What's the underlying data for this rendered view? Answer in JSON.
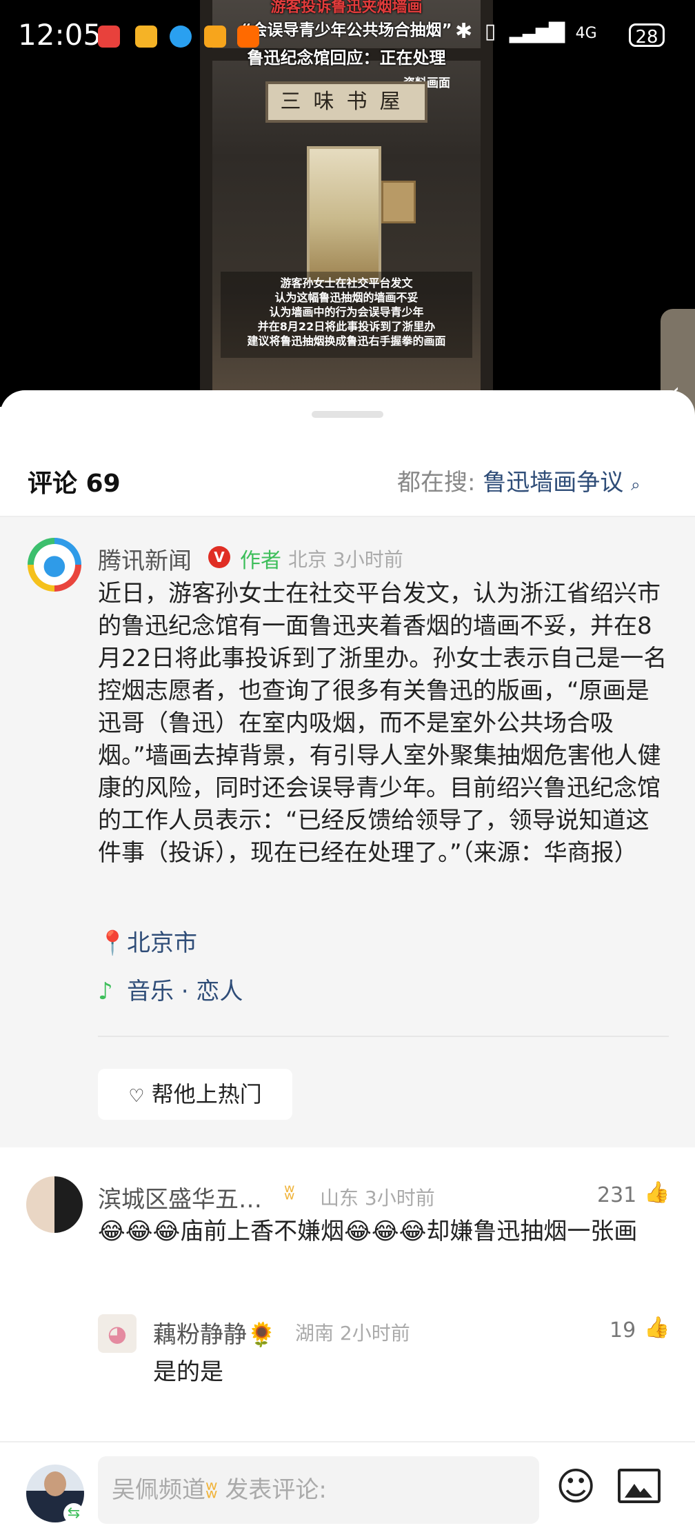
{
  "status_bar": {
    "time": "12:05",
    "network": "4G",
    "battery": "28"
  },
  "video": {
    "caption_line1": "游客投诉鲁迅夹烟墙画",
    "caption_line2": "“会误导青少年公共场合抽烟”",
    "caption_line3": "鲁迅纪念馆回应：正在处理",
    "source_tag": "资料画面",
    "plaque_text": "三味书屋",
    "subtitle_lines": [
      "游客孙女士在社交平台发文",
      "认为这幅鲁迅抽烟的墙画不妥",
      "认为墙画中的行为会误导青少年",
      "并在8月22日将此事投诉到了浙里办",
      "建议将鲁迅抽烟换成鲁迅右手握拳的画面"
    ]
  },
  "comments_header": {
    "title": "评论 69",
    "search_prefix": "都在搜:",
    "search_keyword": "鲁迅墙画争议"
  },
  "pinned_post": {
    "author": "腾讯新闻",
    "verified": "V",
    "tag": "作者",
    "meta": "北京 3小时前",
    "body": "近日，游客孙女士在社交平台发文，认为浙江省绍兴市的鲁迅纪念馆有一面鲁迅夹着香烟的墙画不妥，并在8月22日将此事投诉到了浙里办。孙女士表示自己是一名控烟志愿者，也查询了很多有关鲁迅的版画，“原画是迅哥（鲁迅）在室内吸烟，而不是室外公共场合吸烟。”墙画去掉背景，有引导人室外聚集抽烟危害他人健康的风险，同时还会误导青少年。目前绍兴鲁迅纪念馆的工作人员表示：“已经反馈给领导了，领导说知道这件事（投诉），现在已经在处理了。”（来源：华商报）",
    "location": "北京市",
    "music": "音乐 · 恋人",
    "boost_label": "帮他上热门"
  },
  "comments": [
    {
      "user": "滨城区盛华五…",
      "meta": "山东 3小时前",
      "likes": "231",
      "text": "😂😂😂庙前上香不嫌烟😂😂😂却嫌鲁迅抽烟一张画"
    },
    {
      "user": "藕粉静静🌻",
      "meta": "湖南 2小时前",
      "likes": "19",
      "text": "是的是"
    }
  ],
  "bottom_bar": {
    "placeholder_user": "吴佩频道",
    "placeholder_suffix": " 发表评论:"
  },
  "colors": {
    "link_blue": "#2f4d78",
    "author_green": "#3dbe5a",
    "verified_red": "#e02e24",
    "gold_badge": "#f0b43c"
  },
  "icons": [
    "location-pin-icon",
    "music-note-icon",
    "heart-boost-icon",
    "thumb-up-icon",
    "emoji-icon",
    "image-icon",
    "search-icon",
    "chevron-left-icon"
  ]
}
